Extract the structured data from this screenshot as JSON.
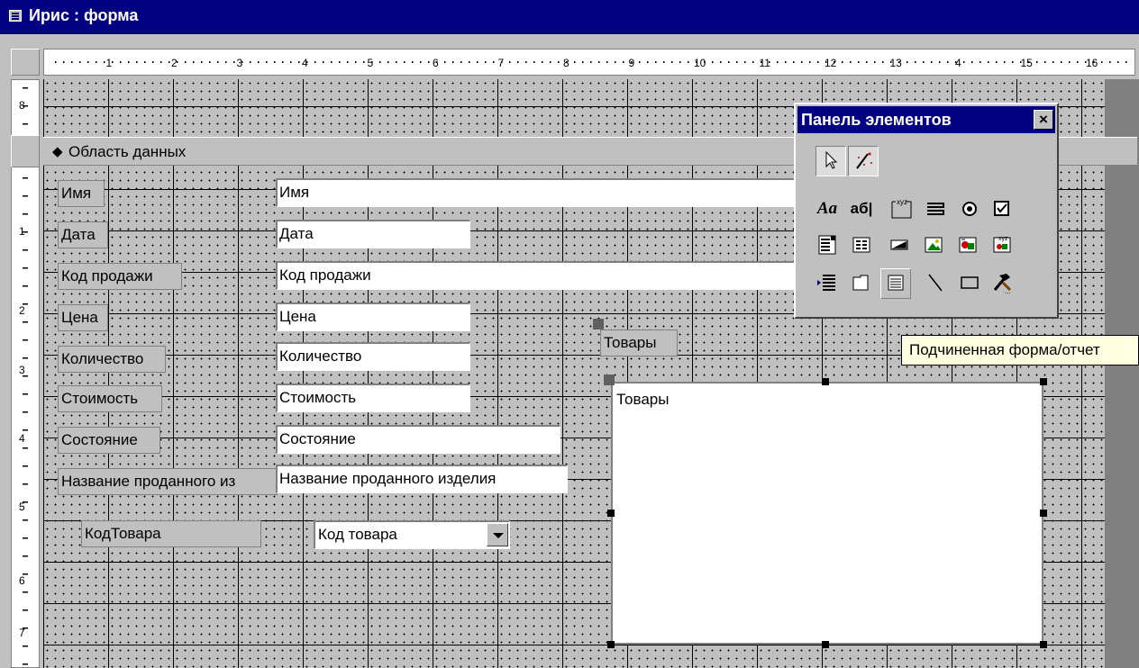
{
  "window": {
    "title": "Ирис : форма"
  },
  "ruler": {
    "h_labels": [
      "1",
      "2",
      "3",
      "4",
      "5",
      "6",
      "7",
      "8",
      "9",
      "10",
      "11",
      "12",
      "13",
      "4",
      "15",
      "16"
    ],
    "v_labels": [
      "8",
      "1",
      "2",
      "3",
      "4",
      "5",
      "6",
      "7"
    ]
  },
  "section": {
    "label": "Область данных"
  },
  "controls": [
    {
      "label": "Имя",
      "field": "Имя"
    },
    {
      "label": "Дата",
      "field": "Дата"
    },
    {
      "label": "Код продажи",
      "field": "Код продажи"
    },
    {
      "label": "Цена",
      "field": "Цена"
    },
    {
      "label": "Количество",
      "field": "Количество"
    },
    {
      "label": "Стоимость",
      "field": "Стоимость"
    },
    {
      "label": "Состояние",
      "field": "Состояние"
    },
    {
      "label": "Название проданного из",
      "field": "Название проданного изделия"
    }
  ],
  "combo": {
    "label": "КодТовара",
    "value": "Код товара"
  },
  "subform": {
    "label": "Товары",
    "content": "Товары"
  },
  "toolbox": {
    "title": "Панель элементов",
    "close": "×",
    "tools": [
      "select-objects",
      "control-wizards",
      "label",
      "text-box",
      "option-group",
      "toggle-button",
      "option-button",
      "check-box",
      "combo-box",
      "list-box",
      "command-button",
      "image",
      "unbound-object-frame",
      "bound-object-frame",
      "page-break",
      "tab-control",
      "subform-subreport",
      "line",
      "rectangle",
      "more-controls"
    ]
  },
  "tooltip": {
    "text": "Подчиненная форма/отчет"
  }
}
